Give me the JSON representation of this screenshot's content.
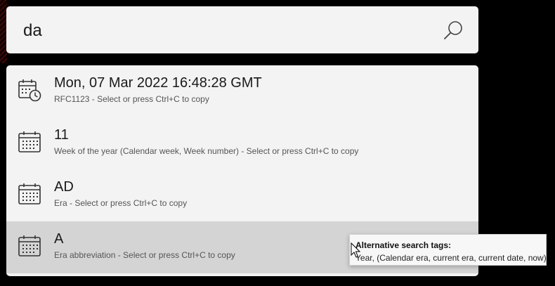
{
  "search": {
    "value": "da",
    "icon": "search-icon"
  },
  "results": [
    {
      "icon": "calendar-clock-icon",
      "title": "Mon, 07 Mar 2022 16:48:28 GMT",
      "subtitle": "RFC1123 - Select or press Ctrl+C to copy",
      "selected": false
    },
    {
      "icon": "calendar-icon",
      "title": "11",
      "subtitle": "Week of the year (Calendar week, Week number) - Select or press Ctrl+C to copy",
      "selected": false
    },
    {
      "icon": "calendar-icon",
      "title": "AD",
      "subtitle": "Era - Select or press Ctrl+C to copy",
      "selected": false
    },
    {
      "icon": "calendar-icon",
      "title": "A",
      "subtitle": "Era abbreviation - Select or press Ctrl+C to copy",
      "selected": true
    }
  ],
  "tooltip": {
    "title": "Alternative search tags:",
    "body": "Year, (Calendar era, current era, current date, now)"
  },
  "colors": {
    "panel": "#f3f3f3",
    "selected_row": "#d4d4d4",
    "background": "#000000"
  }
}
